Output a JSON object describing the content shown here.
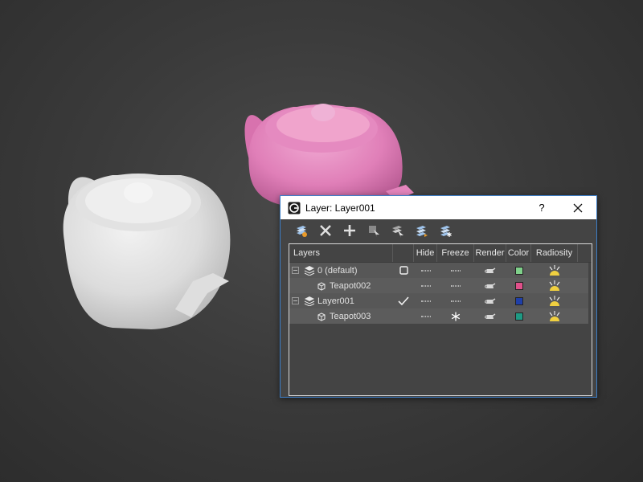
{
  "dialog": {
    "title": "Layer: Layer001",
    "help_label": "?",
    "icons": [
      "3dsmax-app-icon",
      "close-icon"
    ]
  },
  "toolbar": {
    "tools": [
      "create-layer-icon",
      "delete-layer-icon",
      "add-to-layer-icon",
      "select-objects-icon",
      "select-layer-icon",
      "set-current-layer-icon",
      "freeze-layers-icon"
    ]
  },
  "columns": {
    "layers": "Layers",
    "hide": "Hide",
    "freeze": "Freeze",
    "render": "Render",
    "color": "Color",
    "radiosity": "Radiosity"
  },
  "rows": [
    {
      "name": "0 (default)",
      "kind": "layer",
      "current": "checkbox-icon",
      "hide": "dash",
      "freeze": "dash",
      "render": "teapot-icon",
      "color": "#7fd08a",
      "radiosity": "sun-icon"
    },
    {
      "name": "Teapot002",
      "kind": "object",
      "current": "",
      "hide": "dash",
      "freeze": "dash",
      "render": "teapot-icon",
      "color": "#e0508a",
      "radiosity": "sun-icon"
    },
    {
      "name": "Layer001",
      "kind": "layer",
      "current": "checkmark-icon",
      "hide": "dash",
      "freeze": "dash",
      "render": "teapot-icon",
      "color": "#1f3fa8",
      "radiosity": "sun-icon"
    },
    {
      "name": "Teapot003",
      "kind": "object",
      "current": "",
      "hide": "dash",
      "freeze": "snowflake-icon",
      "render": "teapot-icon",
      "color": "#1e9a84",
      "radiosity": "sun-icon"
    }
  ],
  "annotation": {
    "color": "#d01818",
    "marks": "freeze-cell-teapot003"
  },
  "scene": {
    "background": "#3b3b3b",
    "objects": [
      {
        "name": "white-teapot",
        "color": "#e6e6e6"
      },
      {
        "name": "pink-teapot",
        "color": "#e07fb8"
      }
    ]
  }
}
